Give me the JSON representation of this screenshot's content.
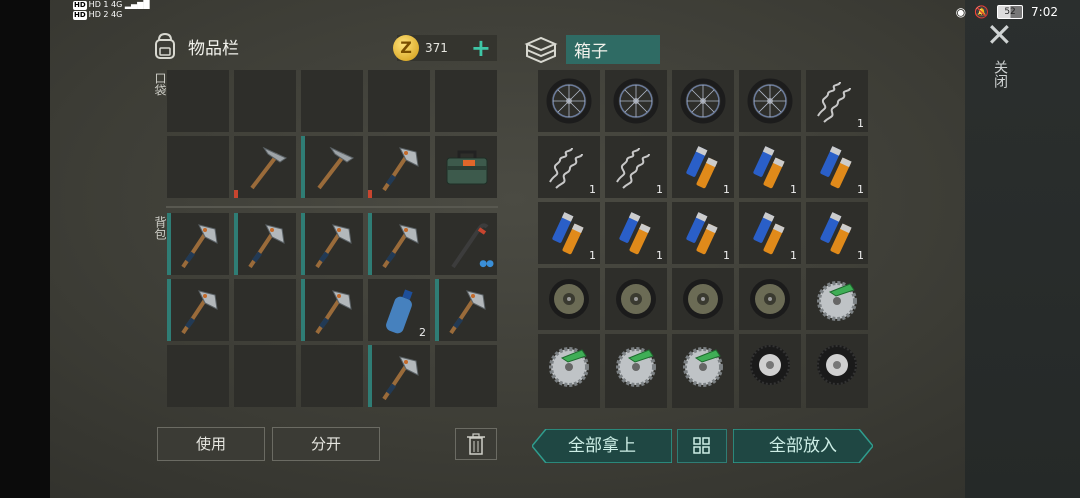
{
  "status_bar": {
    "left_lines": [
      "HD 1 4G",
      "HD 2 4G"
    ],
    "battery": "52",
    "time": "7:02"
  },
  "inventory": {
    "title": "物品栏",
    "coins": "371",
    "pocket_label": "口袋",
    "backpack_label": "背包",
    "use_button": "使用",
    "split_button": "分开"
  },
  "box": {
    "title": "箱子",
    "take_all_button": "全部拿上",
    "put_all_button": "全部放入"
  },
  "close_label": "关闭",
  "colors": {
    "accent_teal": "#2f6b64",
    "button_teal": "#3ec6a6",
    "durability_red": "#c8452f"
  },
  "pocket_slots": [
    {
      "item": ""
    },
    {
      "item": ""
    },
    {
      "item": ""
    },
    {
      "item": ""
    },
    {
      "item": ""
    },
    {
      "item": ""
    },
    {
      "item": "pickaxe",
      "durability": "low"
    },
    {
      "item": "pickaxe",
      "durability": "full"
    },
    {
      "item": "hatchet",
      "durability": "low"
    },
    {
      "item": "toolbox"
    }
  ],
  "backpack_slots": [
    {
      "item": "hatchet"
    },
    {
      "item": "hatchet"
    },
    {
      "item": "hatchet"
    },
    {
      "item": "hatchet"
    },
    {
      "item": "crowbar"
    },
    {
      "item": "hatchet"
    },
    {
      "item": ""
    },
    {
      "item": "hatchet"
    },
    {
      "item": "water-bottle",
      "qty": "2"
    },
    {
      "item": "hatchet"
    },
    {
      "item": ""
    },
    {
      "item": ""
    },
    {
      "item": ""
    },
    {
      "item": "hatchet"
    },
    {
      "item": ""
    }
  ],
  "box_slots": [
    {
      "item": "wheel"
    },
    {
      "item": "wheel"
    },
    {
      "item": "wheel"
    },
    {
      "item": "wheel"
    },
    {
      "item": "spring",
      "qty": "1"
    },
    {
      "item": "spring",
      "qty": "1"
    },
    {
      "item": "spring",
      "qty": "1"
    },
    {
      "item": "battery",
      "qty": "1"
    },
    {
      "item": "battery",
      "qty": "1"
    },
    {
      "item": "battery",
      "qty": "1"
    },
    {
      "item": "battery",
      "qty": "1"
    },
    {
      "item": "battery",
      "qty": "1"
    },
    {
      "item": "battery",
      "qty": "1"
    },
    {
      "item": "battery",
      "qty": "1"
    },
    {
      "item": "battery",
      "qty": "1"
    },
    {
      "item": "brake-disc"
    },
    {
      "item": "brake-disc"
    },
    {
      "item": "brake-disc"
    },
    {
      "item": "brake-disc"
    },
    {
      "item": "saw-blade"
    },
    {
      "item": "saw-blade"
    },
    {
      "item": "saw-blade"
    },
    {
      "item": "saw-blade"
    },
    {
      "item": "tire"
    },
    {
      "item": "tire"
    }
  ]
}
